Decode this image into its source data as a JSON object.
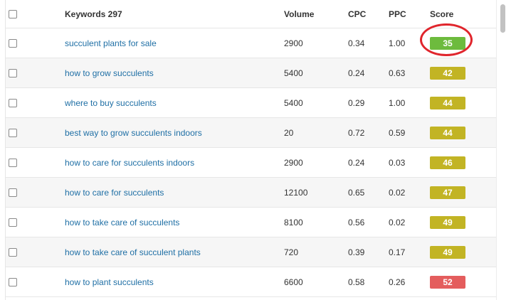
{
  "header": {
    "keywords_label": "Keywords 297",
    "volume_label": "Volume",
    "cpc_label": "CPC",
    "ppc_label": "PPC",
    "score_label": "Score"
  },
  "colors": {
    "score_green": "#6dbb3d",
    "score_olive": "#c2b424",
    "score_red": "#e45d5d",
    "link_blue": "#1f6fa5",
    "highlight_red": "#e0252c"
  },
  "rows": [
    {
      "keyword": "succulent plants for sale",
      "volume": "2900",
      "cpc": "0.34",
      "ppc": "1.00",
      "score": "35",
      "score_color": "#6dbb3d",
      "highlighted": true
    },
    {
      "keyword": "how to grow succulents",
      "volume": "5400",
      "cpc": "0.24",
      "ppc": "0.63",
      "score": "42",
      "score_color": "#c2b424"
    },
    {
      "keyword": "where to buy succulents",
      "volume": "5400",
      "cpc": "0.29",
      "ppc": "1.00",
      "score": "44",
      "score_color": "#c2b424"
    },
    {
      "keyword": "best way to grow succulents indoors",
      "volume": "20",
      "cpc": "0.72",
      "ppc": "0.59",
      "score": "44",
      "score_color": "#c2b424"
    },
    {
      "keyword": "how to care for succulents indoors",
      "volume": "2900",
      "cpc": "0.24",
      "ppc": "0.03",
      "score": "46",
      "score_color": "#c2b424"
    },
    {
      "keyword": "how to care for succulents",
      "volume": "12100",
      "cpc": "0.65",
      "ppc": "0.02",
      "score": "47",
      "score_color": "#c2b424"
    },
    {
      "keyword": "how to take care of succulents",
      "volume": "8100",
      "cpc": "0.56",
      "ppc": "0.02",
      "score": "49",
      "score_color": "#c2b424"
    },
    {
      "keyword": "how to take care of succulent plants",
      "volume": "720",
      "cpc": "0.39",
      "ppc": "0.17",
      "score": "49",
      "score_color": "#c2b424"
    },
    {
      "keyword": "how to plant succulents",
      "volume": "6600",
      "cpc": "0.58",
      "ppc": "0.26",
      "score": "52",
      "score_color": "#e45d5d"
    }
  ]
}
